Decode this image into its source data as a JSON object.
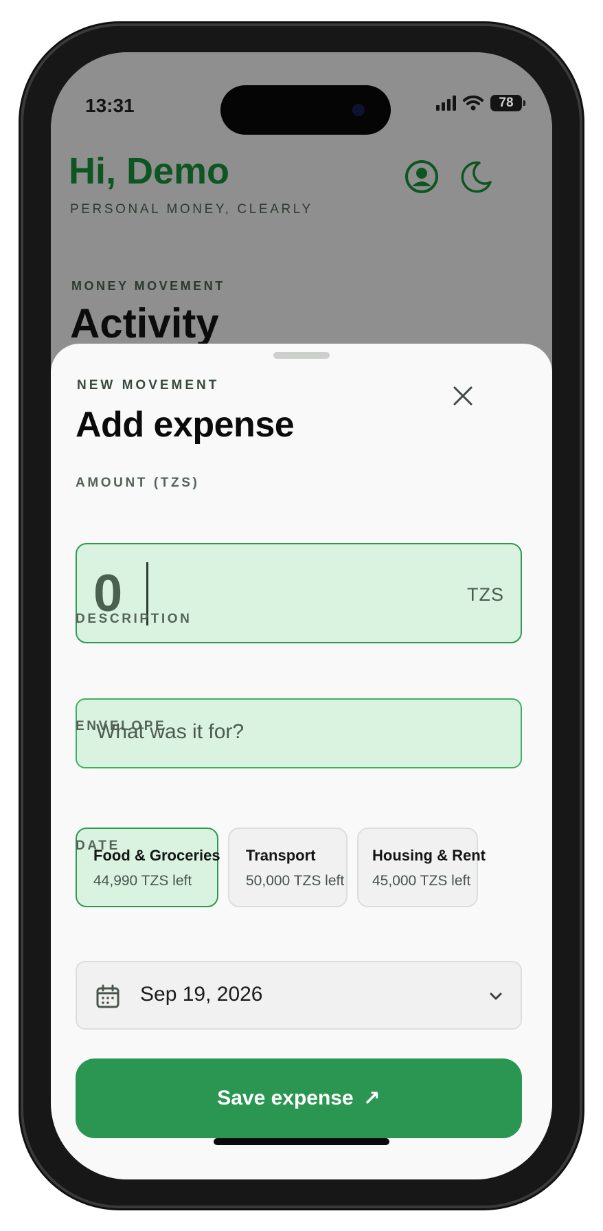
{
  "status_bar": {
    "time": "13:31",
    "battery": "78"
  },
  "header": {
    "greeting": "Hi, Demo",
    "tagline": "PERSONAL MONEY, CLEARLY",
    "profile_icon": "user-circle-icon",
    "theme_icon": "moon-icon"
  },
  "background": {
    "section_eyebrow": "MONEY MOVEMENT",
    "section_title": "Activity"
  },
  "sheet": {
    "eyebrow": "NEW MOVEMENT",
    "title": "Add expense",
    "amount": {
      "label": "AMOUNT (TZS)",
      "value": "0",
      "currency": "TZS"
    },
    "description": {
      "label": "DESCRIPTION",
      "placeholder": "What was it for?"
    },
    "envelope": {
      "label": "ENVELOPE",
      "options": [
        {
          "name": "Food & Groceries",
          "remaining": "44,990 TZS left",
          "selected": true
        },
        {
          "name": "Transport",
          "remaining": "50,000 TZS left",
          "selected": false
        },
        {
          "name": "Housing & Rent",
          "remaining": "45,000 TZS left",
          "selected": false
        }
      ]
    },
    "date": {
      "label": "DATE",
      "value": "Sep 19, 2026"
    },
    "save_label": "Save expense",
    "save_arrow": "↗"
  },
  "colors": {
    "accent": "#2a9651",
    "brand_dark": "#0d5521",
    "field_fill": "#d9f3e0"
  }
}
